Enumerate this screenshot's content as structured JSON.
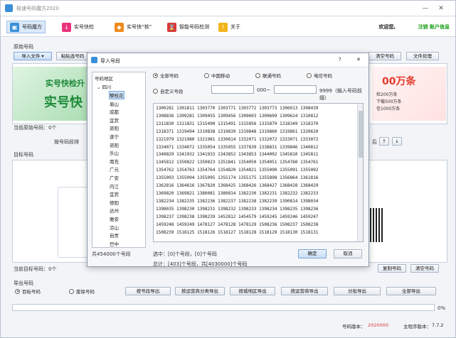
{
  "window": {
    "title": "极速号码魔方2020",
    "min": "—",
    "close": "✕"
  },
  "toolbar": {
    "items": [
      {
        "label": "号码魔方",
        "icon": "cube-icon",
        "color": "#3a8fd8"
      },
      {
        "label": "实号快检",
        "icon": "download-icon",
        "color": "#e8347a"
      },
      {
        "label": "实号快“核”",
        "icon": "shield-icon",
        "color": "#f08a1c"
      },
      {
        "label": "智能号码检测",
        "icon": "hourglass-icon",
        "color": "#d83a3a"
      },
      {
        "label": "关于",
        "icon": "info-icon",
        "color": "#f2b51b"
      }
    ],
    "welcome": "欢迎您,",
    "registered": "注销 账户信息"
  },
  "source": {
    "section": "原始号码",
    "import_btn": "导入文件 ▾",
    "paste_btn": "粘贴选号码",
    "clear_btn": "清空号码",
    "process_btn": "文件处理",
    "count": "当前原始号码：0个",
    "banner_t1": "实号快检升",
    "banner_t2": "实号快",
    "banner2_big": "00万条",
    "banner2_l1": "检200万条",
    "banner2_l2": "下载500万条",
    "banner2_l3": "信1000万条"
  },
  "sort": {
    "label": "按号码段排",
    "up": "↑",
    "down": "↓",
    "mid": "后"
  },
  "target": {
    "section": "目标号码",
    "count": "当前目标号码：0个",
    "copy_btn": "复制号码",
    "clear_btn": "清空号码"
  },
  "export": {
    "section": "导出号码",
    "opt1": "目标号码",
    "opt2": "废除号码",
    "buttons": [
      "按号段导出",
      "按运营商分类导出",
      "按城地区导出",
      "按运营商导出",
      "分批导出",
      "全部导出"
    ]
  },
  "progress": {
    "pct": "0%",
    "value": 0
  },
  "status": {
    "version_label": "号码版本：",
    "version": "2020000",
    "main_label": "主程序版本：",
    "main": "7.7.2"
  },
  "dialog": {
    "title": "导入号段",
    "help": "?",
    "close": "✕",
    "tree_header": "号码地区",
    "province": "四川",
    "cities": [
      "攀枝花",
      "眉山",
      "成都",
      "宜宾",
      "资阳",
      "遂宁",
      "资阳",
      "乐山",
      "南充",
      "广元",
      "广安",
      "内江",
      "宜宾",
      "德阳",
      "达州",
      "雅安",
      "凉山",
      "自贡",
      "巴中"
    ],
    "opt_all": "全部号码",
    "opt_mobile": "中国移动",
    "opt_unicom": "联通号码",
    "opt_telecom": "电信号码",
    "opt_custom": "自定义号段",
    "custom_mid": "000~",
    "custom_end": "9999（输入号码前缀）",
    "numbers": [
      [
        "1300281",
        "1301811",
        "1303770",
        "1303771",
        "1303772",
        "1303773",
        "1306013",
        "1308439"
      ],
      [
        "1308836",
        "1309281",
        "1309455",
        "1309456",
        "1309603",
        "1309609",
        "1309624",
        "1310812"
      ],
      [
        "1311830",
        "1311831",
        "1315490",
        "1315491",
        "1315856",
        "1315879",
        "1318349",
        "1318370"
      ],
      [
        "1318371",
        "1319494",
        "1319838",
        "1319839",
        "1319848",
        "1319860",
        "1319861",
        "1320620"
      ],
      [
        "1321979",
        "1321980",
        "1321981",
        "1330814",
        "1332071",
        "1332072",
        "1333071",
        "1333072"
      ],
      [
        "1334071",
        "1334072",
        "1335054",
        "1335055",
        "1337839",
        "1338831",
        "1339846",
        "1340812"
      ],
      [
        "1340829",
        "1341932",
        "1341933",
        "1343852",
        "1343853",
        "1344002",
        "1345810",
        "1345811"
      ],
      [
        "1345812",
        "1350822",
        "1350823",
        "1351841",
        "1354050",
        "1354051",
        "1354760",
        "1354761"
      ],
      [
        "1354762",
        "1354763",
        "1354764",
        "1354820",
        "1354821",
        "1355090",
        "1355091",
        "1355092"
      ],
      [
        "1355093",
        "1355094",
        "1355095",
        "1355174",
        "1355175",
        "1355898",
        "1356864",
        "1361816"
      ],
      [
        "1362816",
        "1364816",
        "1367820",
        "1368425",
        "1368426",
        "1368427",
        "1368428",
        "1368429"
      ],
      [
        "1369820",
        "1369821",
        "1380081",
        "1380814",
        "1382230",
        "1382231",
        "1382232",
        "1382233"
      ],
      [
        "1382234",
        "1382235",
        "1382236",
        "1382237",
        "1382238",
        "1382239",
        "1390814",
        "1398034"
      ],
      [
        "1398035",
        "1398230",
        "1398231",
        "1398232",
        "1398233",
        "1398234",
        "1398235",
        "1398236"
      ],
      [
        "1398237",
        "1398238",
        "1398239",
        "1452812",
        "1454579",
        "1459245",
        "1459246",
        "1459247"
      ],
      [
        "1459248",
        "1459249",
        "1478127",
        "1478128",
        "1478129",
        "1508236",
        "1508237",
        "1508238"
      ],
      [
        "1508239",
        "1518125",
        "1518126",
        "1518127",
        "1518128",
        "1518129",
        "1518130",
        "1518131"
      ]
    ],
    "total_numbers": "共454000个号段",
    "selected": "选中：[0]个号段，[0]个号码",
    "summary": "总计：[403]个号段，共[4030000]个号码",
    "ok": "确定",
    "cancel": "取消"
  }
}
